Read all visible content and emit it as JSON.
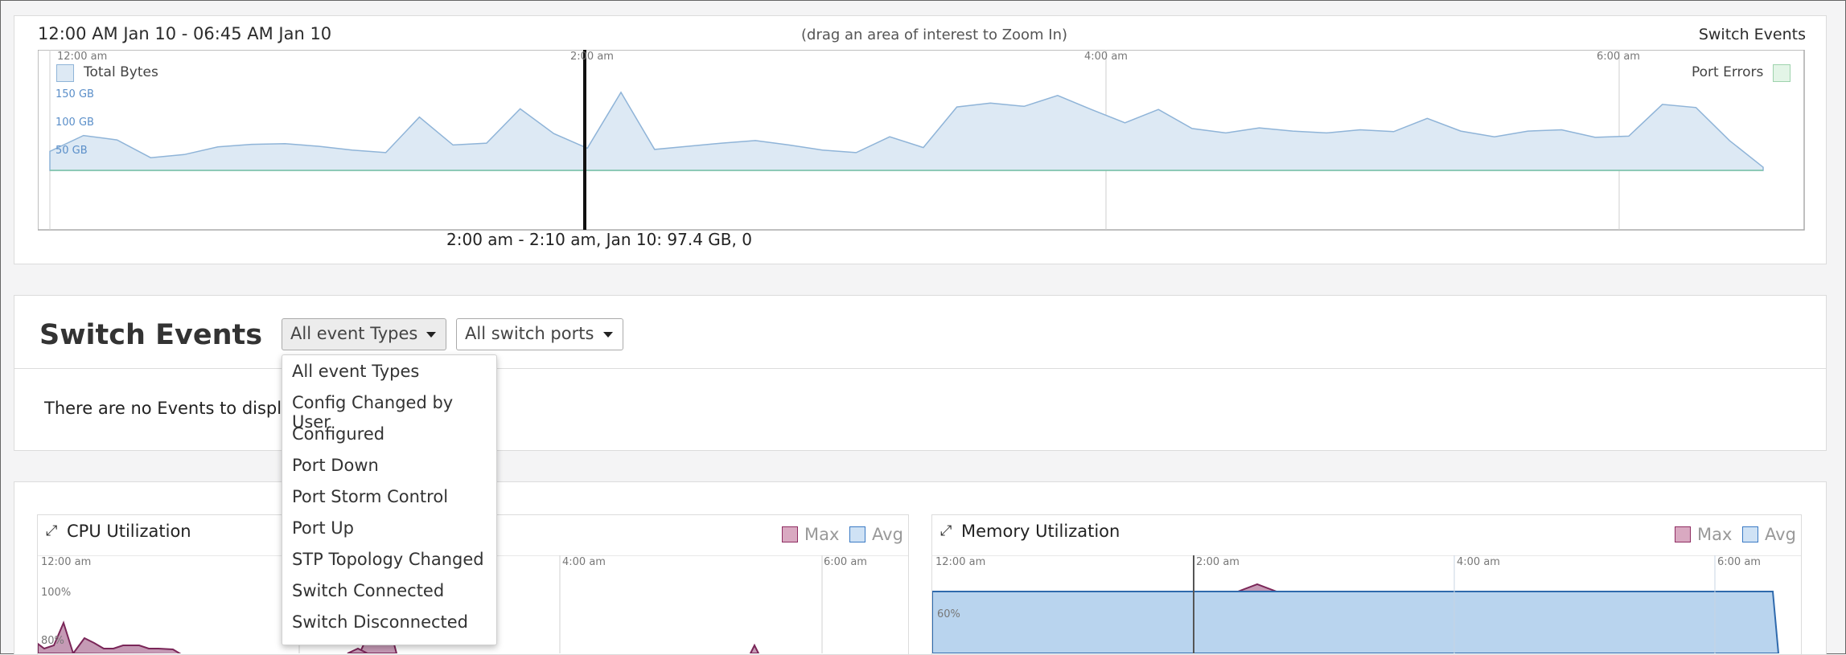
{
  "timeline": {
    "range_label": "12:00 AM Jan 10 - 06:45 AM Jan 10",
    "hint": "(drag an area of interest to Zoom In)",
    "right_title": "Switch Events",
    "legend_total": "Total Bytes",
    "legend_errors": "Port Errors",
    "tick_labels": [
      "12:00 am",
      "2:00 am",
      "4:00 am",
      "6:00 am"
    ],
    "y_labels": [
      "150 GB",
      "100 GB",
      "50 GB"
    ],
    "cursor_label": "2:00 am - 2:10 am, Jan 10: 97.4 GB, 0",
    "colors": {
      "area": "#dde9f4",
      "line": "#8fb4d8",
      "errors": "#7dc6a6"
    }
  },
  "chart_data": {
    "type": "area",
    "x_labels": [
      "12:00 am",
      "2:00 am",
      "4:00 am",
      "6:00 am"
    ],
    "y_labels": [
      "150 GB",
      "100 GB",
      "50 GB"
    ],
    "series": [
      {
        "name": "Total Bytes",
        "values": [
          30,
          55,
          48,
          20,
          25,
          37,
          41,
          42,
          38,
          32,
          28,
          84,
          40,
          43,
          97,
          58,
          35,
          123,
          33,
          38,
          43,
          47,
          40,
          32,
          28,
          53,
          36,
          100,
          106,
          101,
          118,
          96,
          75,
          96,
          66,
          59,
          67,
          62,
          59,
          64,
          61,
          82,
          62,
          53,
          62,
          64,
          52,
          54,
          104,
          99,
          47,
          5
        ]
      },
      {
        "name": "Port Errors",
        "values": [
          0,
          0
        ]
      }
    ]
  },
  "events": {
    "title": "Switch Events",
    "event_type_selected": "All event Types",
    "port_selected": "All switch ports",
    "empty_text": "There are no Events to display",
    "menu_items": [
      "All event Types",
      "Config Changed by User",
      "Configured",
      "Port Down",
      "Port Storm Control",
      "Port Up",
      "STP Topology Changed",
      "Switch Connected",
      "Switch Disconnected"
    ]
  },
  "cpu": {
    "title": "CPU Utilization",
    "legend_max": "Max",
    "legend_avg": "Avg",
    "tick_labels": [
      "12:00 am",
      "4:00 am",
      "6:00 am"
    ],
    "y_labels": [
      "100%",
      "80%"
    ]
  },
  "memory": {
    "title": "Memory Utilization",
    "legend_max": "Max",
    "legend_avg": "Avg",
    "tick_labels": [
      "12:00 am",
      "2:00 am",
      "4:00 am",
      "6:00 am"
    ],
    "y_labels": [
      "60%"
    ]
  },
  "colors": {
    "max": "#b77e9f",
    "avg": "#a8c8e8"
  }
}
